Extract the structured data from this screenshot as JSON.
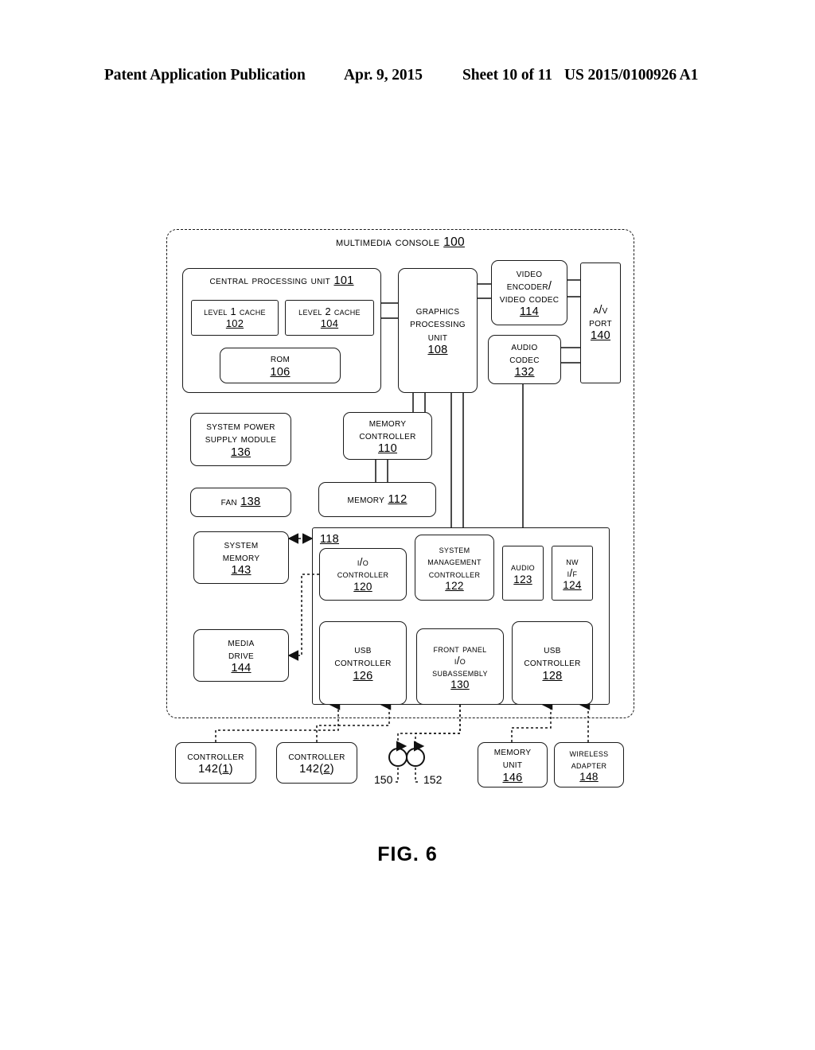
{
  "header": {
    "publication": "Patent Application Publication",
    "date": "Apr. 9, 2015",
    "sheet": "Sheet 10 of 11",
    "number": "US 2015/0100926 A1"
  },
  "figure": {
    "caption": "FIG. 6"
  },
  "diagram": {
    "console": {
      "title": "Multimedia Console",
      "ref": "100"
    },
    "cpu": {
      "title": "Central Processing Unit",
      "ref": "101",
      "l1_cache": {
        "title": "Level 1 Cache",
        "ref": "102"
      },
      "l2_cache": {
        "title": "Level 2 Cache",
        "ref": "104"
      },
      "rom": {
        "title": "ROM",
        "ref": "106"
      }
    },
    "gpu": {
      "line1": "Graphics",
      "line2": "Processing",
      "line3": "Unit",
      "ref": "108"
    },
    "video_codec": {
      "line1": "Video",
      "line2": "Encoder/",
      "line3": "Video Codec",
      "ref": "114"
    },
    "audio_codec": {
      "line1": "Audio",
      "line2": "Codec",
      "ref": "132"
    },
    "av_port": {
      "line1": "A/V",
      "line2": "Port",
      "ref": "140"
    },
    "power_supply": {
      "line1": "System Power",
      "line2": "Supply Module",
      "ref": "136"
    },
    "fan": {
      "title": "Fan",
      "ref": "138"
    },
    "memory_controller": {
      "line1": "Memory",
      "line2": "Controller",
      "ref": "110"
    },
    "memory": {
      "title": "Memory",
      "ref": "112"
    },
    "system_memory": {
      "line1": "System",
      "line2": "Memory",
      "ref": "143"
    },
    "media_drive": {
      "line1": "Media",
      "line2": "Drive",
      "ref": "144"
    },
    "io_container": {
      "ref": "118"
    },
    "io_controller": {
      "line1": "I/O",
      "line2": "Controller",
      "ref": "120"
    },
    "system_mgmt": {
      "line1": "System",
      "line2": "Management",
      "line3": "Controller",
      "ref": "122"
    },
    "audio": {
      "line1": "Audio",
      "ref": "123"
    },
    "nw_if": {
      "line1": "NW",
      "line2": "I/F",
      "ref": "124"
    },
    "usb_controller_126": {
      "line1": "USB",
      "line2": "Controller",
      "ref": "126"
    },
    "front_panel": {
      "line1": "Front Panel",
      "line2": "I/O",
      "line3": "Subassembly",
      "ref": "130"
    },
    "usb_controller_128": {
      "line1": "USB",
      "line2": "Controller",
      "ref": "128"
    },
    "controller_1": {
      "title": "Controller",
      "ref": "142(1)"
    },
    "controller_2": {
      "title": "Controller",
      "ref": "142(2)"
    },
    "memory_unit": {
      "line1": "Memory",
      "line2": "Unit",
      "ref": "146"
    },
    "wireless_adapter": {
      "line1": "Wireless",
      "line2": "Adapter",
      "ref": "148"
    },
    "node_150": {
      "ref": "150"
    },
    "node_152": {
      "ref": "152"
    }
  }
}
